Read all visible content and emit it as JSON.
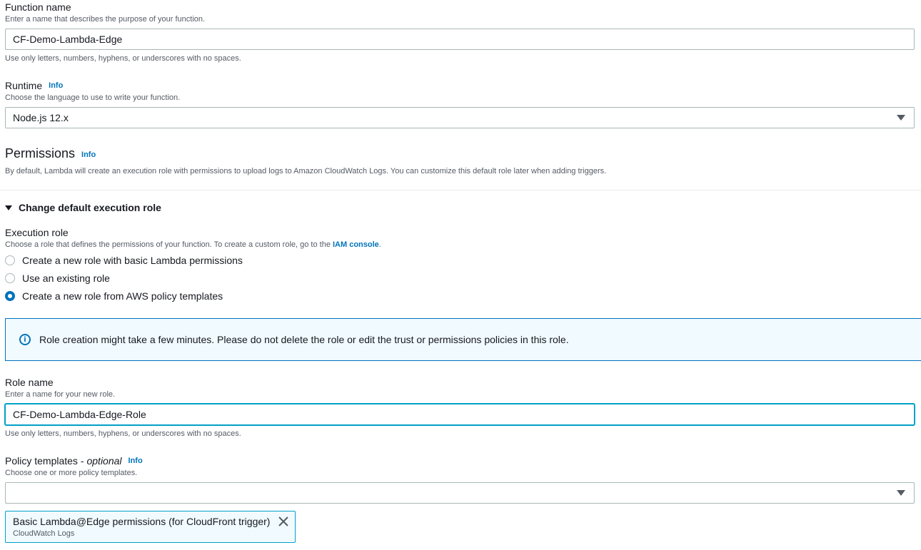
{
  "function_name": {
    "label": "Function name",
    "description": "Enter a name that describes the purpose of your function.",
    "value": "CF-Demo-Lambda-Edge",
    "constraint": "Use only letters, numbers, hyphens, or underscores with no spaces."
  },
  "runtime": {
    "label": "Runtime",
    "info": "Info",
    "description": "Choose the language to use to write your function.",
    "value": "Node.js 12.x"
  },
  "permissions": {
    "heading": "Permissions",
    "info": "Info",
    "description": "By default, Lambda will create an execution role with permissions to upload logs to Amazon CloudWatch Logs. You can customize this default role later when adding triggers."
  },
  "expander": {
    "label": "Change default execution role"
  },
  "execution_role": {
    "label": "Execution role",
    "description_prefix": "Choose a role that defines the permissions of your function. To create a custom role, go to the ",
    "iam_link": "IAM console",
    "description_suffix": ".",
    "options": [
      {
        "label": "Create a new role with basic Lambda permissions",
        "checked": false
      },
      {
        "label": "Use an existing role",
        "checked": false
      },
      {
        "label": "Create a new role from AWS policy templates",
        "checked": true
      }
    ]
  },
  "alert": {
    "text": "Role creation might take a few minutes. Please do not delete the role or edit the trust or permissions policies in this role."
  },
  "role_name": {
    "label": "Role name",
    "description": "Enter a name for your new role.",
    "value": "CF-Demo-Lambda-Edge-Role",
    "constraint": "Use only letters, numbers, hyphens, or underscores with no spaces."
  },
  "policy_templates": {
    "label": "Policy templates - ",
    "optional": "optional",
    "info": "Info",
    "description": "Choose one or more policy templates.",
    "value": "",
    "selected": [
      {
        "title": "Basic Lambda@Edge permissions (for CloudFront trigger)",
        "subtitle": "CloudWatch Logs"
      }
    ]
  },
  "colors": {
    "link": "#0073bb",
    "focus": "#00a1c9",
    "alert_bg": "#f1faff",
    "text": "#16191f",
    "muted": "#545b64"
  }
}
